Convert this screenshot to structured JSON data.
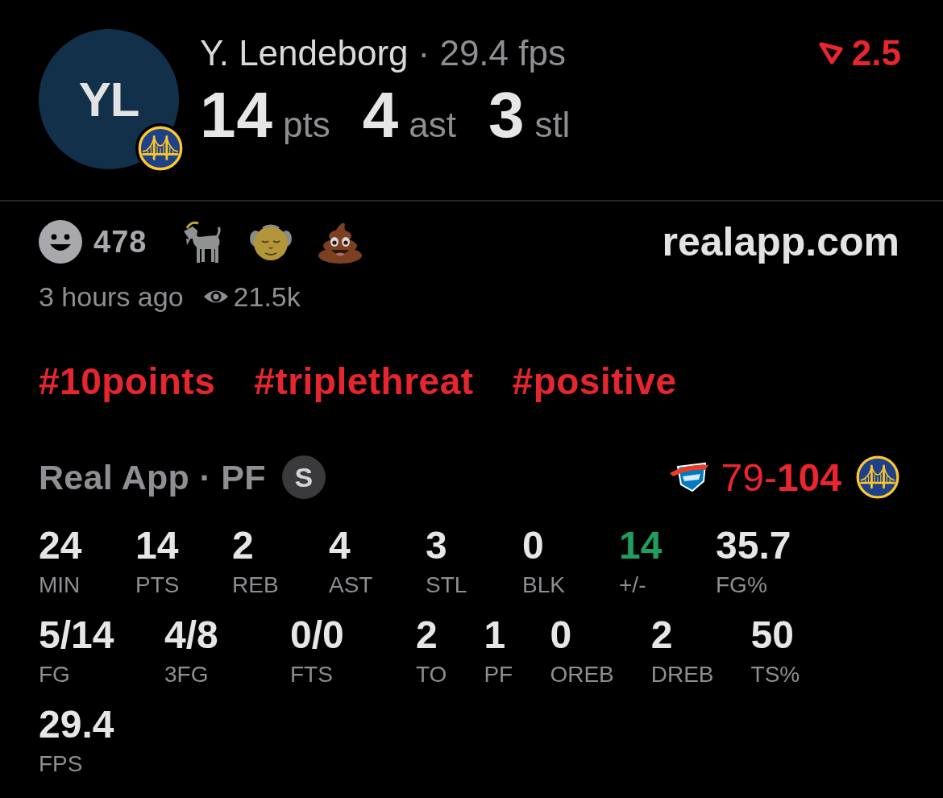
{
  "player": {
    "initials": "YL",
    "name": "Y. Lendeborg",
    "subtitle": "· 29.4 fps",
    "headline_stats": [
      {
        "value": "14",
        "unit": "pts"
      },
      {
        "value": "4",
        "unit": "ast"
      },
      {
        "value": "3",
        "unit": "stl"
      }
    ],
    "change": "2.5"
  },
  "reactions": {
    "count": "478",
    "emojis": [
      {
        "kind": "goat"
      },
      {
        "kind": "old-man"
      },
      {
        "kind": "poop"
      }
    ]
  },
  "site": "realapp.com",
  "meta": {
    "posted": "3 hours ago",
    "views": "21.5k"
  },
  "hashtags": [
    "#10points",
    "#triplethreat",
    "#positive"
  ],
  "game": {
    "source": "Real App · PF",
    "badge": "S",
    "score": "79-**104**"
  },
  "stat_rows": [
    [
      {
        "value": "24",
        "label": "MIN",
        "color": "#e6e6e6"
      },
      {
        "value": "14",
        "label": "PTS",
        "color": "#e6e6e6"
      },
      {
        "value": "2",
        "label": "REB",
        "color": "#e6e6e6"
      },
      {
        "value": "4",
        "label": "AST",
        "color": "#e6e6e6"
      },
      {
        "value": "3",
        "label": "STL",
        "color": "#e6e6e6"
      },
      {
        "value": "0",
        "label": "BLK",
        "color": "#e6e6e6"
      },
      {
        "value": "14",
        "label": "+/-",
        "color": "#1f9e5e"
      },
      {
        "value": "35.7",
        "label": "FG%",
        "color": "#e6e6e6"
      }
    ],
    [
      {
        "value": "5/14",
        "label": "FG",
        "color": "#e6e6e6"
      },
      {
        "value": "4/8",
        "label": "3FG",
        "color": "#e6e6e6"
      },
      {
        "value": "0/0",
        "label": "FTS",
        "color": "#e6e6e6"
      },
      {
        "value": "2",
        "label": "TO",
        "color": "#e6e6e6"
      },
      {
        "value": "1",
        "label": "PF",
        "color": "#e6e6e6"
      },
      {
        "value": "0",
        "label": "OREB",
        "color": "#e6e6e6"
      },
      {
        "value": "2",
        "label": "DREB",
        "color": "#e6e6e6"
      },
      {
        "value": "50",
        "label": "TS%",
        "color": "#e6e6e6"
      }
    ],
    [
      {
        "value": "29.4",
        "label": "FPS",
        "color": "#e6e6e6"
      }
    ]
  ]
}
